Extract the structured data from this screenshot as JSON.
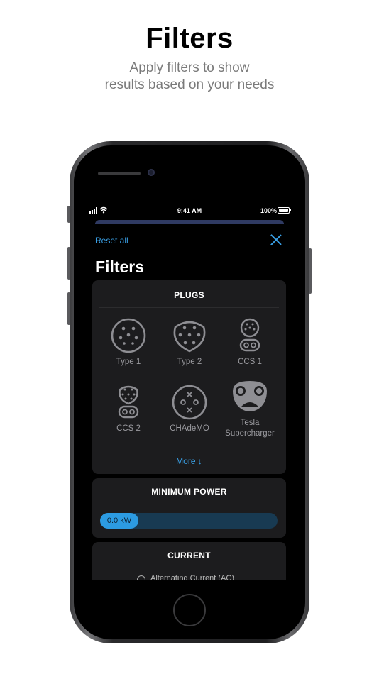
{
  "hero": {
    "title": "Filters",
    "subtitle_line1": "Apply filters to show",
    "subtitle_line2": "results based on your needs"
  },
  "status_bar": {
    "time": "9:41 AM",
    "battery": "100%",
    "icons": [
      "signal-icon",
      "wifi-icon",
      "battery-icon"
    ]
  },
  "header": {
    "reset_label": "Reset all",
    "close_icon": "close-icon",
    "title": "Filters"
  },
  "plugs": {
    "heading": "PLUGS",
    "items": [
      {
        "label": "Type 1",
        "icon": "type1-plug-icon"
      },
      {
        "label": "Type 2",
        "icon": "type2-plug-icon"
      },
      {
        "label": "CCS 1",
        "icon": "ccs1-plug-icon"
      },
      {
        "label": "CCS 2",
        "icon": "ccs2-plug-icon"
      },
      {
        "label": "CHAdeMO",
        "icon": "chademo-plug-icon"
      },
      {
        "label": "Tesla Supercharger",
        "icon": "tesla-plug-icon"
      }
    ],
    "more_label": "More ↓"
  },
  "minimum_power": {
    "heading": "MINIMUM POWER",
    "value": "0.0 kW"
  },
  "current": {
    "heading": "CURRENT",
    "option_ac": "Alternating Current (AC)"
  },
  "colors": {
    "accent": "#3aa0e6",
    "card": "#1c1c1e",
    "slider_track": "#183a52",
    "slider_knob": "#2c9be2",
    "icon_gray": "#8e8e93"
  }
}
